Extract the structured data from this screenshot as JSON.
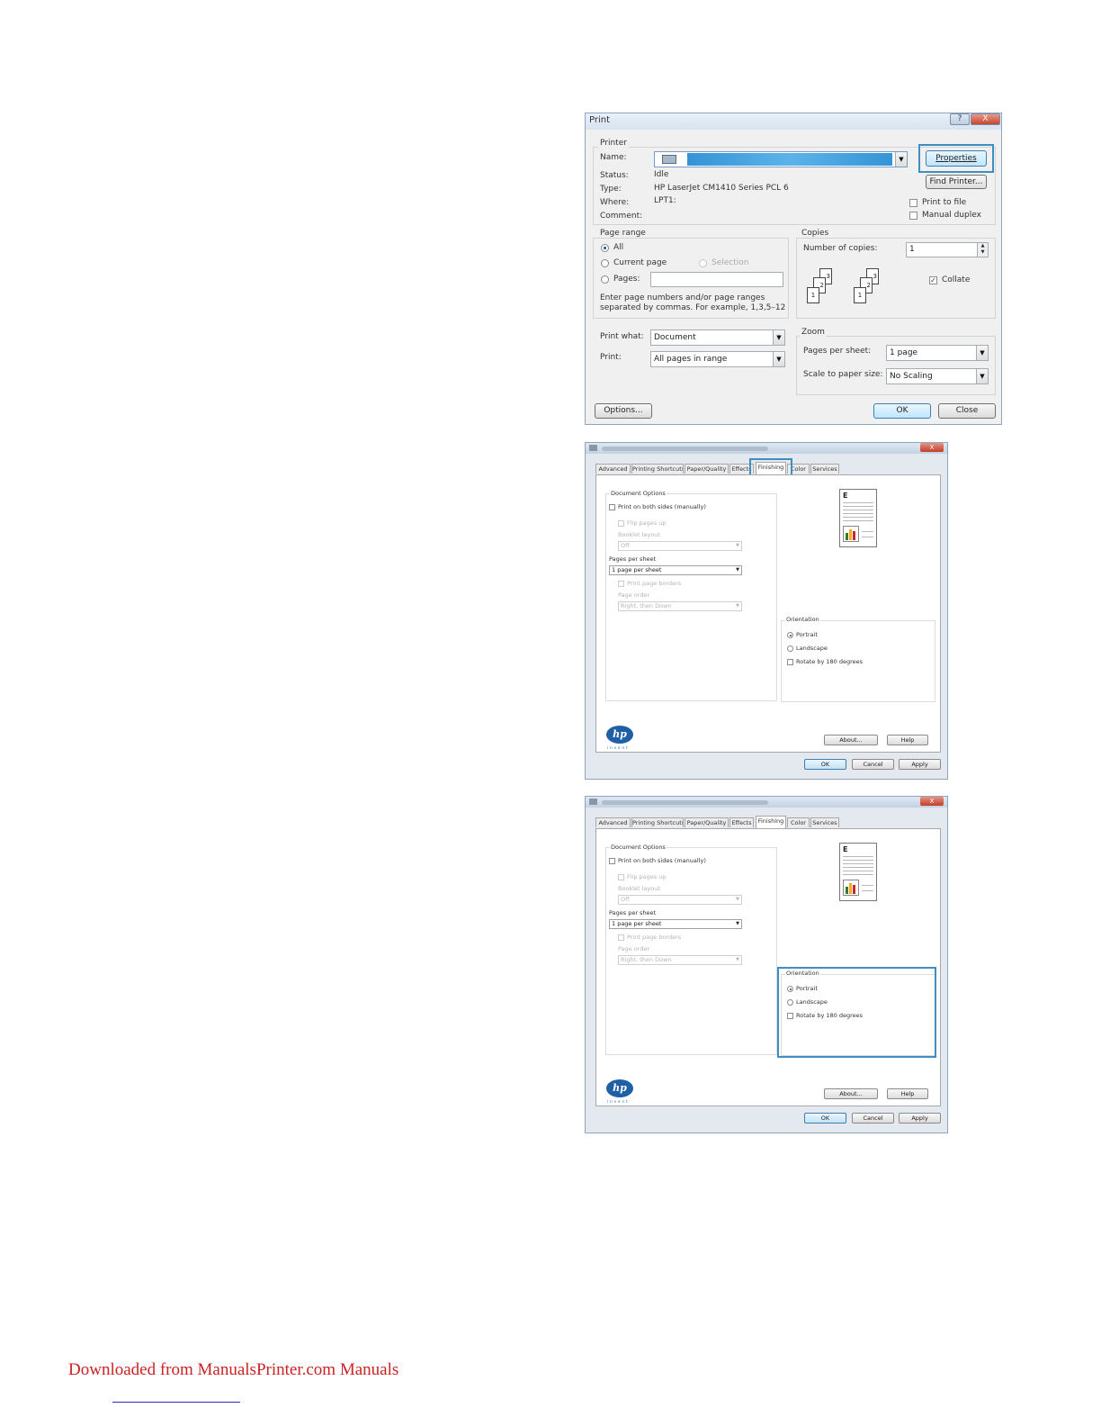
{
  "print_dialog": {
    "title": "Print",
    "help_btn": "?",
    "close_btn": "X",
    "printer_group": "Printer",
    "name_label": "Name:",
    "status_label": "Status:",
    "status_value": "Idle",
    "type_label": "Type:",
    "type_value": "HP LaserJet CM1410 Series PCL 6",
    "where_label": "Where:",
    "where_value": "LPT1:",
    "comment_label": "Comment:",
    "properties_btn": "Properties",
    "find_printer_btn": "Find Printer...",
    "print_to_file": "Print to file",
    "manual_duplex": "Manual duplex",
    "page_range_group": "Page range",
    "all_label": "All",
    "current_page_label": "Current page",
    "selection_label": "Selection",
    "pages_label": "Pages:",
    "hint_line1": "Enter page numbers and/or page ranges",
    "hint_line2": "separated by commas.  For example, 1,3,5–12",
    "copies_group": "Copies",
    "number_of_copies_label": "Number of copies:",
    "copies_value": "1",
    "collate_label": "Collate",
    "collate_icon_numbers": [
      "3",
      "2",
      "1",
      "3",
      "2",
      "1"
    ],
    "print_what_label": "Print what:",
    "print_what_value": "Document",
    "print_label": "Print:",
    "print_value": "All pages in range",
    "zoom_group": "Zoom",
    "pages_per_sheet_label": "Pages per sheet:",
    "pages_per_sheet_value": "1 page",
    "scale_label": "Scale to paper size:",
    "scale_value": "No Scaling",
    "options_btn": "Options...",
    "ok_btn": "OK",
    "close_button": "Close"
  },
  "properties_dialog": {
    "close_btn": "X",
    "tabs": [
      "Advanced",
      "Printing Shortcuts",
      "Paper/Quality",
      "Effects",
      "Finishing",
      "Color",
      "Services"
    ],
    "active_tab": "Finishing",
    "document_options": "Document Options",
    "print_both_sides": "Print on both sides (manually)",
    "flip_pages_up": "Flip pages up",
    "booklet_layout": "Booklet layout",
    "booklet_value": "Off",
    "pages_per_sheet": "Pages per sheet",
    "pages_per_sheet_value": "1 page per sheet",
    "print_page_borders": "Print page borders",
    "page_order": "Page order",
    "page_order_value": "Right, then Down",
    "orientation": "Orientation",
    "portrait": "Portrait",
    "landscape": "Landscape",
    "rotate": "Rotate by 180 degrees",
    "preview_letter": "E",
    "logo_text": "hp",
    "logo_tagline": "invent",
    "about_btn": "About...",
    "help_btn": "Help",
    "ok_btn": "OK",
    "cancel_btn": "Cancel",
    "apply_btn": "Apply"
  },
  "footer": {
    "link_text": "Downloaded from ManualsPrinter.com Manuals"
  }
}
